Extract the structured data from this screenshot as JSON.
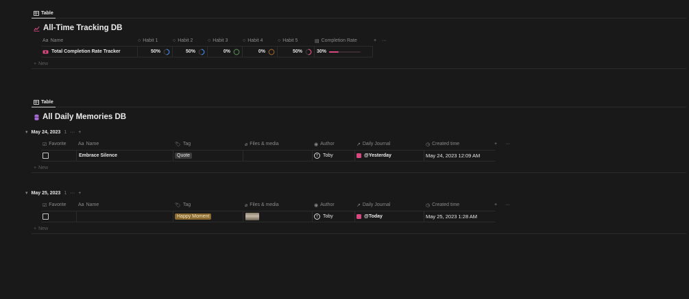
{
  "section1": {
    "tab_label": "Table",
    "db_title": "All-Time Tracking DB",
    "columns": [
      "Name",
      "Habit 1",
      "Habit 2",
      "Habit 3",
      "Habit 4",
      "Habit 5",
      "Completion Rate"
    ],
    "row": {
      "name": "Total Completion Rate Tracker",
      "habits": [
        "50%",
        "50%",
        "0%",
        "0%",
        "50%"
      ],
      "habit_values": [
        0.5,
        0.5,
        0,
        0,
        0.5
      ],
      "habit_colors": [
        "#3c7bd6",
        "#3c7bd6",
        "#4c7a4c",
        "#8a5a2a",
        "#d6487e"
      ],
      "completion": "30%",
      "completion_value": 0.3
    },
    "new_label": "New"
  },
  "section2": {
    "tab_label": "Table",
    "db_title": "All Daily Memories DB",
    "columns": [
      "Favorite",
      "Name",
      "Tag",
      "Files & media",
      "Author",
      "Daily Journal",
      "Created time"
    ],
    "groups": [
      {
        "label": "May 24, 2023",
        "count": "1",
        "row": {
          "name": "Embrace Silence",
          "tag": "Quote",
          "author": "Toby",
          "journal": "@Yesterday",
          "created": "May 24, 2023 12:09 AM"
        }
      },
      {
        "label": "May 25, 2023",
        "count": "1",
        "row": {
          "name": "",
          "tag": "Happy Moment",
          "author": "Toby",
          "journal": "@Today",
          "created": "May 25, 2023 1:28 AM"
        }
      }
    ],
    "new_label": "New"
  },
  "colors": {
    "accent_pink": "#d6487e",
    "background": "#191919",
    "tag_happy": "#8a6a2e",
    "tag_quote": "#3c3c3c"
  }
}
